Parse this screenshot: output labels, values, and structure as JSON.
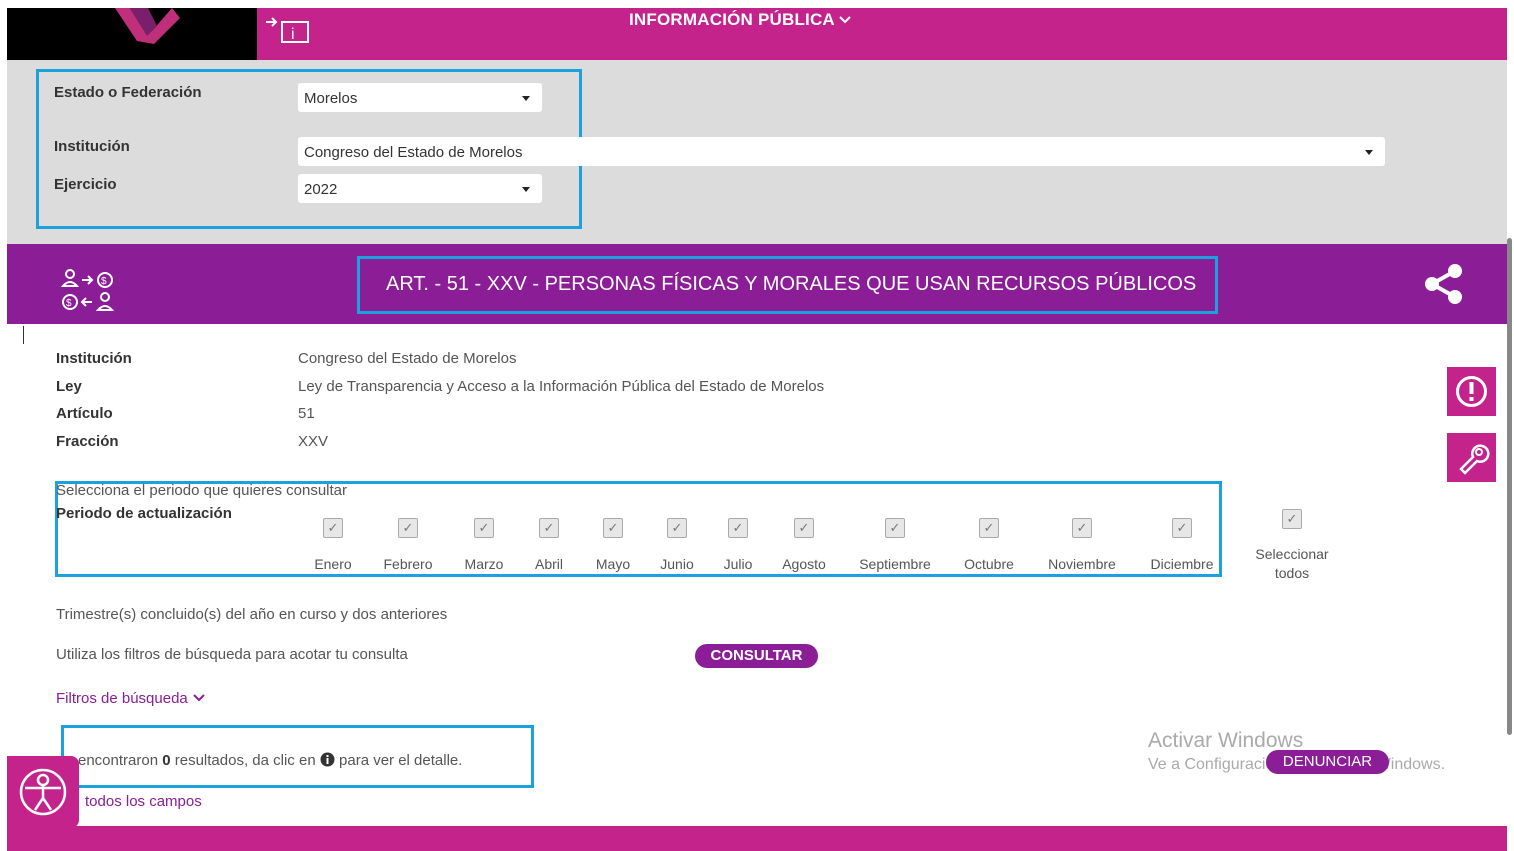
{
  "header": {
    "title": "INFORMACIÓN PÚBLICA",
    "title_chevron": "chevron-down-icon"
  },
  "filters": {
    "estado": {
      "label": "Estado o Federación",
      "value": "Morelos"
    },
    "institucion": {
      "label": "Institución",
      "value": "Congreso del Estado de Morelos"
    },
    "ejercicio": {
      "label": "Ejercicio",
      "value": "2022"
    }
  },
  "article": {
    "title": "ART. - 51 - XXV - PERSONAS FÍSICAS Y MORALES QUE USAN RECURSOS PÚBLICOS",
    "icon": "exchange-people-money-icon",
    "share_icon": "share-icon"
  },
  "details": [
    {
      "label": "Institución",
      "value": "Congreso del Estado de Morelos"
    },
    {
      "label": "Ley",
      "value": "Ley de Transparencia y Acceso a la Información Pública del Estado de Morelos"
    },
    {
      "label": "Artículo",
      "value": "51"
    },
    {
      "label": "Fracción",
      "value": "XXV"
    }
  ],
  "period": {
    "instruction": "Selecciona el periodo que quieres consultar",
    "label": "Periodo de actualización",
    "months": [
      "Enero",
      "Febrero",
      "Marzo",
      "Abril",
      "Mayo",
      "Junio",
      "Julio",
      "Agosto",
      "Septiembre",
      "Octubre",
      "Noviembre",
      "Diciembre"
    ],
    "checked": true,
    "select_all_line1": "Seleccionar",
    "select_all_line2": "todos"
  },
  "notes": {
    "trimestre": "Trimestre(s) concluido(s) del año en curso y dos anteriores",
    "filtros_hint": "Utiliza los filtros de búsqueda para acotar tu consulta",
    "consult_button": "CONSULTAR",
    "filtros_link": "Filtros de búsqueda"
  },
  "results": {
    "prefix": "encontraron",
    "count": "0",
    "middle": "resultados, da clic en",
    "suffix": "para ver el detalle.",
    "all_fields_link": "todos los campos"
  },
  "side_buttons": [
    "alert-icon",
    "wrench-icon"
  ],
  "denunciar": "DENUNCIAR",
  "watermark": {
    "line1": "Activar Windows",
    "line2": "Ve a Configuración para activar Windows."
  },
  "colors": {
    "magenta": "#c4238c",
    "purple": "#8b1d97",
    "highlight": "#1ba0e0",
    "gray": "#dcdcdc"
  }
}
